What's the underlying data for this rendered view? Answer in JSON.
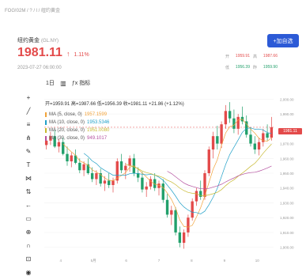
{
  "breadcrumb": "FOG!02M / ? / l / 纽约黄金",
  "instrument": {
    "name": "纽约黄金",
    "code": "(GL.NY)"
  },
  "price": {
    "value": "1981.11",
    "change_pct": "1.11%",
    "arrow": "↑",
    "time": "2023-07-27 06:00:00"
  },
  "stats": [
    {
      "label": "开",
      "value": "1959.91",
      "color": "#e34a4a"
    },
    {
      "label": "高",
      "value": "1987.66",
      "color": "#e34a4a"
    },
    {
      "label": "低",
      "value": "1956.39",
      "color": "#22a06b"
    },
    {
      "label": "昨",
      "value": "1959.90",
      "color": "#22a06b"
    }
  ],
  "buttons": {
    "add": "+加自选"
  },
  "toolbar": {
    "period": "1日",
    "indicators_label": "指标"
  },
  "ohlc_line": "开=1959.91  高=1987.66  低=1956.39  收=1981.11  +21.86 (+1.12%)",
  "ma_legend": [
    {
      "label": "MA (5, close, 0)",
      "value": "1957.1599",
      "color": "#f2a33a"
    },
    {
      "label": "MA (10, close, 0)",
      "value": "1953.5346",
      "color": "#21a0c8"
    },
    {
      "label": "MA (20, close, 0)",
      "value": "1951.0080",
      "color": "#c7b92f"
    },
    {
      "label": "MA (30, close, 0)",
      "value": "949.1017",
      "color": "#b4509f"
    }
  ],
  "y_axis_ticks": [
    "2,000.00",
    "1,990.00",
    "1,980.00",
    "1,970.00",
    "1,960.00",
    "1,950.00",
    "1,940.00",
    "1,930.00",
    "1,920.00",
    "1,910.00",
    "1,900.00"
  ],
  "current_price_tag": "1981.11",
  "x_axis_ticks": [
    "4",
    "5月",
    "6",
    "7",
    "8",
    "9",
    "10"
  ],
  "chart_data": {
    "type": "candlestick",
    "ylim": [
      1895,
      2005
    ],
    "candles": [
      [
        1969,
        1975,
        1966,
        1972
      ],
      [
        1972,
        1978,
        1969,
        1975
      ],
      [
        1975,
        1979,
        1967,
        1968
      ],
      [
        1968,
        1973,
        1964,
        1971
      ],
      [
        1971,
        1974,
        1962,
        1963
      ],
      [
        1963,
        1968,
        1955,
        1958
      ],
      [
        1958,
        1964,
        1954,
        1962
      ],
      [
        1962,
        1966,
        1956,
        1957
      ],
      [
        1957,
        1960,
        1950,
        1952
      ],
      [
        1952,
        1958,
        1948,
        1956
      ],
      [
        1956,
        1960,
        1949,
        1950
      ],
      [
        1950,
        1954,
        1944,
        1946
      ],
      [
        1946,
        1952,
        1942,
        1950
      ],
      [
        1950,
        1953,
        1941,
        1943
      ],
      [
        1943,
        1948,
        1938,
        1945
      ],
      [
        1945,
        1950,
        1940,
        1942
      ],
      [
        1942,
        1947,
        1937,
        1945
      ],
      [
        1945,
        1960,
        1943,
        1958
      ],
      [
        1958,
        1963,
        1950,
        1952
      ],
      [
        1952,
        1957,
        1946,
        1955
      ],
      [
        1955,
        1962,
        1951,
        1960
      ],
      [
        1960,
        1963,
        1948,
        1950
      ],
      [
        1950,
        1954,
        1944,
        1947
      ],
      [
        1947,
        1951,
        1937,
        1939
      ],
      [
        1939,
        1944,
        1934,
        1941
      ],
      [
        1941,
        1948,
        1939,
        1946
      ],
      [
        1946,
        1950,
        1938,
        1940
      ],
      [
        1940,
        1945,
        1935,
        1943
      ],
      [
        1943,
        1946,
        1930,
        1932
      ],
      [
        1932,
        1936,
        1920,
        1922
      ],
      [
        1922,
        1928,
        1915,
        1925
      ],
      [
        1925,
        1927,
        1908,
        1910
      ],
      [
        1910,
        1914,
        1900,
        1903
      ],
      [
        1903,
        1912,
        1899,
        1910
      ],
      [
        1910,
        1922,
        1907,
        1920
      ],
      [
        1920,
        1933,
        1918,
        1931
      ],
      [
        1931,
        1940,
        1928,
        1938
      ],
      [
        1938,
        1945,
        1932,
        1934
      ],
      [
        1934,
        1952,
        1932,
        1950
      ],
      [
        1950,
        1968,
        1948,
        1966
      ],
      [
        1966,
        1978,
        1960,
        1975
      ],
      [
        1975,
        1982,
        1966,
        1970
      ],
      [
        1970,
        1985,
        1967,
        1983
      ],
      [
        1983,
        1996,
        1980,
        1992
      ],
      [
        1992,
        1998,
        1984,
        1987
      ],
      [
        1987,
        1993,
        1977,
        1980
      ],
      [
        1980,
        1990,
        1976,
        1988
      ],
      [
        1988,
        1995,
        1983,
        1985
      ],
      [
        1985,
        1989,
        1974,
        1976
      ],
      [
        1976,
        1981,
        1968,
        1970
      ],
      [
        1970,
        1975,
        1963,
        1966
      ],
      [
        1966,
        1974,
        1962,
        1971
      ],
      [
        1971,
        1980,
        1968,
        1977
      ],
      [
        1977,
        1983,
        1972,
        1974
      ],
      [
        1974,
        1988,
        1972,
        1981
      ]
    ]
  }
}
